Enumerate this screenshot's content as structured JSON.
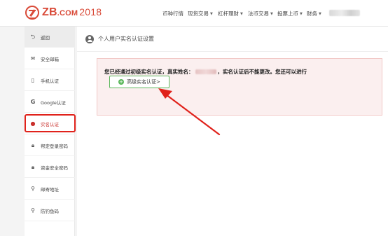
{
  "header": {
    "logo": {
      "brand": "ZB",
      "dotcom": ".COM",
      "year": "2018"
    },
    "nav": [
      {
        "label": "币种行情",
        "dropdown": false
      },
      {
        "label": "现货交易",
        "dropdown": true
      },
      {
        "label": "杠杆理财",
        "dropdown": true
      },
      {
        "label": "法币交易",
        "dropdown": true
      },
      {
        "label": "投票上币",
        "dropdown": true
      },
      {
        "label": "财务",
        "dropdown": true
      }
    ]
  },
  "sidebar": {
    "items": [
      {
        "icon": "back-arrow-icon",
        "label": "返回"
      },
      {
        "icon": "envelope-icon",
        "label": "安全邮箱"
      },
      {
        "icon": "mobile-phone-icon",
        "label": "手机认证"
      },
      {
        "icon": "google-icon",
        "label": "Google认证"
      },
      {
        "icon": "user-icon",
        "label": "实名认证"
      },
      {
        "icon": "lock-icon",
        "label": "帮定登录密码"
      },
      {
        "icon": "lock-icon",
        "label": "资金安全密码"
      },
      {
        "icon": "map-marker-icon",
        "label": "邮寄地址"
      },
      {
        "icon": "map-marker-icon",
        "label": "防钓鱼码"
      }
    ],
    "active_index": 4
  },
  "main": {
    "title": "个人用户实名认证设置",
    "notice": {
      "text_before": "您已经通过初级实名认证，真实姓名：",
      "text_after": "，实名认证后不能更改。您还可以进行",
      "button_label": "高级实名认证>",
      "button_icon": "plus-circle-icon"
    }
  },
  "colors": {
    "brand_red": "#d94a38",
    "highlight_red": "#e0221b",
    "button_green": "#5cb85c",
    "notice_bg": "#fbefef"
  }
}
